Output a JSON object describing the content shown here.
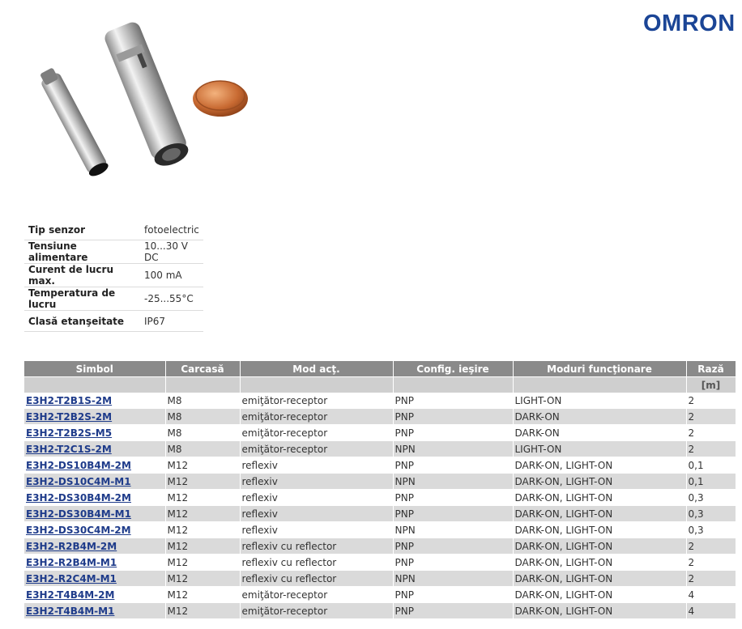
{
  "brand": {
    "logo_text": "OMRON",
    "color": "#1b4596"
  },
  "photo": {
    "subject": "product-photo-sensors-and-coin"
  },
  "specs": [
    {
      "label": "Tip senzor",
      "value": "fotoelectric"
    },
    {
      "label": "Tensiune alimentare",
      "value": "10...30 V DC"
    },
    {
      "label": "Curent de lucru max.",
      "value": "100 mA"
    },
    {
      "label": "Temperatura de lucru",
      "value": "-25...55°C"
    },
    {
      "label": "Clasă etanşeitate",
      "value": "IP67"
    }
  ],
  "products_table": {
    "headers": [
      "Simbol",
      "Carcasă",
      "Mod acţ.",
      "Config. ieşire",
      "Moduri funcţionare",
      "Rază"
    ],
    "units": [
      "",
      "",
      "",
      "",
      "",
      "[m]"
    ],
    "rows": [
      [
        "E3H2-T2B1S-2M",
        "M8",
        "emiţător-receptor",
        "PNP",
        "LIGHT-ON",
        "2"
      ],
      [
        "E3H2-T2B2S-2M",
        "M8",
        "emiţător-receptor",
        "PNP",
        "DARK-ON",
        "2"
      ],
      [
        "E3H2-T2B2S-M5",
        "M8",
        "emiţător-receptor",
        "PNP",
        "DARK-ON",
        "2"
      ],
      [
        "E3H2-T2C1S-2M",
        "M8",
        "emiţător-receptor",
        "NPN",
        "LIGHT-ON",
        "2"
      ],
      [
        "E3H2-DS10B4M-2M",
        "M12",
        "reflexiv",
        "PNP",
        "DARK-ON, LIGHT-ON",
        "0,1"
      ],
      [
        "E3H2-DS10C4M-M1",
        "M12",
        "reflexiv",
        "NPN",
        "DARK-ON, LIGHT-ON",
        "0,1"
      ],
      [
        "E3H2-DS30B4M-2M",
        "M12",
        "reflexiv",
        "PNP",
        "DARK-ON, LIGHT-ON",
        "0,3"
      ],
      [
        "E3H2-DS30B4M-M1",
        "M12",
        "reflexiv",
        "PNP",
        "DARK-ON, LIGHT-ON",
        "0,3"
      ],
      [
        "E3H2-DS30C4M-2M",
        "M12",
        "reflexiv",
        "NPN",
        "DARK-ON, LIGHT-ON",
        "0,3"
      ],
      [
        "E3H2-R2B4M-2M",
        "M12",
        "reflexiv cu reflector",
        "PNP",
        "DARK-ON, LIGHT-ON",
        "2"
      ],
      [
        "E3H2-R2B4M-M1",
        "M12",
        "reflexiv cu reflector",
        "PNP",
        "DARK-ON, LIGHT-ON",
        "2"
      ],
      [
        "E3H2-R2C4M-M1",
        "M12",
        "reflexiv cu reflector",
        "NPN",
        "DARK-ON, LIGHT-ON",
        "2"
      ],
      [
        "E3H2-T4B4M-2M",
        "M12",
        "emiţător-receptor",
        "PNP",
        "DARK-ON, LIGHT-ON",
        "4"
      ],
      [
        "E3H2-T4B4M-M1",
        "M12",
        "emiţător-receptor",
        "PNP",
        "DARK-ON, LIGHT-ON",
        "4"
      ]
    ]
  },
  "colors": {
    "header_bg": "#8a8a8a",
    "subheader_bg": "#cfcfcf",
    "row_alt_bg": "#dadada",
    "link": "#1e3b8a"
  }
}
